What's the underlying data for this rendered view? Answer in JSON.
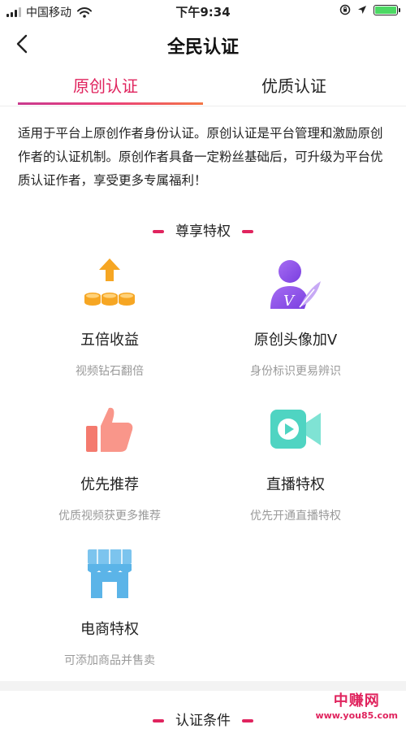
{
  "status": {
    "carrier": "中国移动",
    "time": "下午9:34"
  },
  "nav": {
    "title": "全民认证"
  },
  "tabs": [
    {
      "label": "原创认证",
      "active": true
    },
    {
      "label": "优质认证",
      "active": false
    }
  ],
  "description": "适用于平台上原创作者身份认证。原创认证是平台管理和激励原创作者的认证机制。原创作者具备一定粉丝基础后，可升级为平台优质认证作者，享受更多专属福利！",
  "privileges_header": "尊享特权",
  "privileges": [
    {
      "title": "五倍收益",
      "subtitle": "视频钻石翻倍",
      "icon": "coins-up-icon"
    },
    {
      "title": "原创头像加V",
      "subtitle": "身份标识更易辨识",
      "icon": "avatar-v-icon"
    },
    {
      "title": "优先推荐",
      "subtitle": "优质视频获更多推荐",
      "icon": "thumbs-up-icon"
    },
    {
      "title": "直播特权",
      "subtitle": "优先开通直播特权",
      "icon": "video-camera-icon"
    },
    {
      "title": "电商特权",
      "subtitle": "可添加商品并售卖",
      "icon": "store-icon"
    }
  ],
  "conditions_header": "认证条件",
  "watermark": {
    "line1": "中赚网",
    "line2": "www.you85.com"
  },
  "colors": {
    "accent": "#e0245e",
    "icon_orange": "#f6a623",
    "icon_purple": "#8f4fe6",
    "icon_coral": "#f47a6e",
    "icon_teal": "#4fd4c2",
    "icon_blue": "#5bb4e8"
  }
}
